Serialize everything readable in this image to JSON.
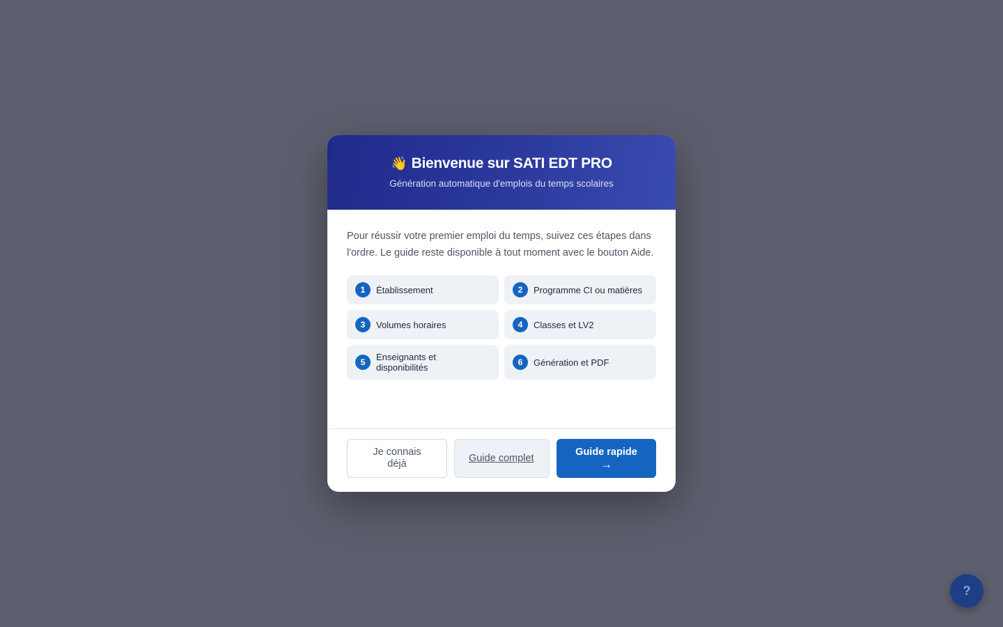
{
  "modal": {
    "icon": "waving-hand-icon",
    "icon_glyph": "👋",
    "title": "Bienvenue sur SATI EDT PRO",
    "subtitle": "Génération automatique d'emplois du temps scolaires",
    "intro": "Pour réussir votre premier emploi du temps, suivez ces étapes dans l'ordre. Le guide reste disponible à tout moment avec le bouton Aide.",
    "steps": [
      {
        "number": "1",
        "label": "Établissement"
      },
      {
        "number": "2",
        "label": "Programme CI ou matières"
      },
      {
        "number": "3",
        "label": "Volumes horaires"
      },
      {
        "number": "4",
        "label": "Classes et LV2"
      },
      {
        "number": "5",
        "label": "Enseignants et disponibilités"
      },
      {
        "number": "6",
        "label": "Génération et PDF"
      }
    ],
    "buttons": {
      "skip": "Je connais déjà",
      "full_guide": "Guide complet",
      "quick_guide": "Guide rapide",
      "quick_guide_arrow": "→"
    }
  },
  "help_button": {
    "icon": "question-mark-icon",
    "glyph": "?"
  },
  "colors": {
    "backdrop": "#5d5f6e",
    "header_start": "#1f2a8a",
    "header_end": "#3a4bb0",
    "accent": "#1565c0",
    "step_bg": "#eef1f6"
  }
}
